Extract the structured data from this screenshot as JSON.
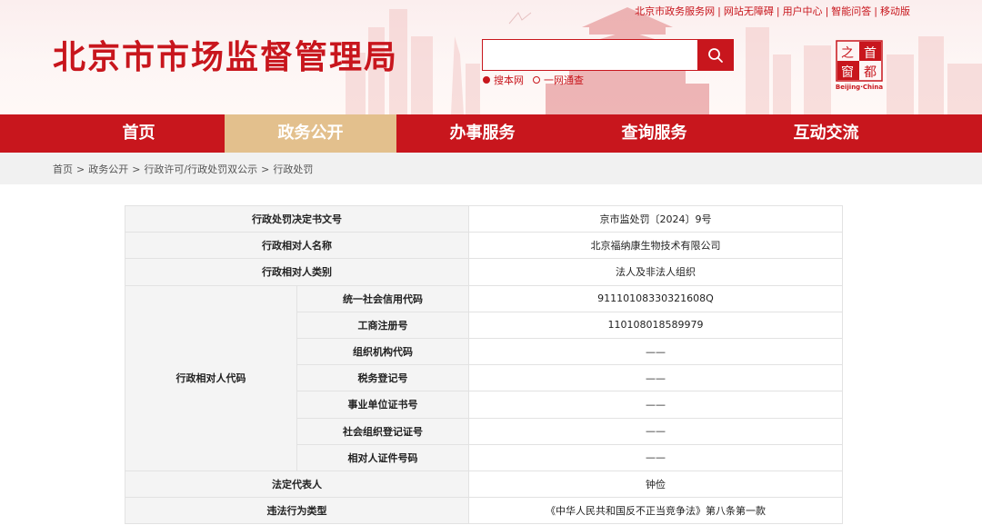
{
  "header": {
    "site_title": "北京市市场监督管理局",
    "top_links": [
      "北京市政务服务网",
      "网站无障碍",
      "用户中心",
      "智能问答",
      "移动版"
    ],
    "search": {
      "placeholder": "",
      "options": [
        {
          "label": "搜本网",
          "selected": true
        },
        {
          "label": "一网通查",
          "selected": false
        }
      ]
    },
    "logo": {
      "text_en": "Beijing·China",
      "glyphs": [
        "之",
        "首",
        "窗",
        "都"
      ]
    }
  },
  "nav": {
    "items": [
      "首页",
      "政务公开",
      "办事服务",
      "查询服务",
      "互动交流"
    ],
    "active_index": 1
  },
  "breadcrumb": [
    "首页",
    "政务公开",
    "行政许可/行政处罚双公示",
    "行政处罚"
  ],
  "table": {
    "decision_no": {
      "label": "行政处罚决定书文号",
      "value": "京市监处罚〔2024〕9号"
    },
    "party_name": {
      "label": "行政相对人名称",
      "value": "北京福纳康生物技术有限公司"
    },
    "party_type": {
      "label": "行政相对人类别",
      "value": "法人及非法人组织"
    },
    "party_code": {
      "label": "行政相对人代码",
      "rows": [
        {
          "label": "统一社会信用代码",
          "value": "91110108330321608Q"
        },
        {
          "label": "工商注册号",
          "value": "110108018589979"
        },
        {
          "label": "组织机构代码",
          "value": "——"
        },
        {
          "label": "税务登记号",
          "value": "——"
        },
        {
          "label": "事业单位证书号",
          "value": "——"
        },
        {
          "label": "社会组织登记证号",
          "value": "——"
        },
        {
          "label": "相对人证件号码",
          "value": "——"
        }
      ]
    },
    "legal_rep": {
      "label": "法定代表人",
      "value": "钟俭"
    },
    "violation_type": {
      "label": "违法行为类型",
      "value": "《中华人民共和国反不正当竞争法》第八条第一款"
    }
  },
  "colors": {
    "brand_red": "#c8161d",
    "nav_active": "#e3c08d",
    "label_bg": "#f4f4f4"
  }
}
